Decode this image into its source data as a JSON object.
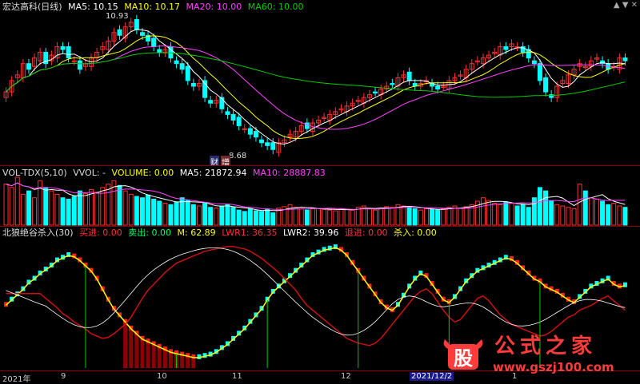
{
  "price_pane": {
    "title": "宏达高科(日线)",
    "ma5": "MA5: 10.15",
    "ma10": "MA10: 10.17",
    "ma20": "MA20: 10.00",
    "ma60": "MA60: 10.00",
    "high_marker": "10.93",
    "low_marker": "8.68",
    "tag_cai": "财",
    "tag_zeng": "增",
    "controls": "▲ ▼ ✕",
    "colors": {
      "ma5": "#ffffff",
      "ma10": "#ffff00",
      "ma20": "#ff44ff",
      "ma60": "#00cc00",
      "up": "#ff3030",
      "down": "#00ffff"
    }
  },
  "volume_pane": {
    "title": "VOL-TDX(5,10)",
    "vvol": "VVOL: -",
    "volume": "VOLUME: 0.00",
    "ma5": "MA5: 21872.94",
    "ma10": "MA10: 28887.83"
  },
  "indicator_pane": {
    "title": "北狼绝谷杀入(30)",
    "buy": "买进: 0.00",
    "sell": "卖出: 0.00",
    "m": "M: 62.89",
    "lwr1": "LWR1: 36.35",
    "lwr2": "LWR2: 39.96",
    "exit": "退进: 0.00",
    "kill": "杀入: 0.00"
  },
  "time_axis": {
    "labels": [
      "2021年",
      "9",
      "10",
      "11",
      "12",
      "2021/12/2",
      "1"
    ],
    "active": "2021/12/2"
  },
  "watermark": {
    "badge": "股",
    "title": "公式之家",
    "url": "www.gszj100.com"
  },
  "chart_data": {
    "type": "candlestick",
    "closes": [
      9.7,
      9.9,
      10.0,
      10.2,
      10.1,
      10.3,
      10.4,
      10.2,
      10.35,
      10.5,
      10.45,
      10.3,
      10.25,
      10.1,
      10.2,
      10.3,
      10.4,
      10.5,
      10.6,
      10.75,
      10.7,
      10.85,
      10.93,
      10.8,
      10.7,
      10.6,
      10.5,
      10.4,
      10.45,
      10.3,
      10.2,
      10.1,
      9.9,
      9.8,
      9.85,
      9.6,
      9.5,
      9.55,
      9.4,
      9.3,
      9.2,
      9.1,
      9.05,
      8.95,
      8.9,
      8.8,
      8.75,
      8.68,
      8.8,
      8.85,
      8.95,
      9.0,
      9.1,
      9.05,
      9.15,
      9.2,
      9.25,
      9.3,
      9.35,
      9.4,
      9.45,
      9.5,
      9.55,
      9.6,
      9.65,
      9.7,
      9.75,
      9.8,
      9.85,
      9.95,
      10.0,
      9.9,
      9.8,
      9.85,
      9.9,
      9.8,
      9.75,
      9.8,
      9.9,
      9.95,
      10.0,
      10.1,
      10.2,
      10.25,
      10.3,
      10.35,
      10.4,
      10.5,
      10.45,
      10.55,
      10.5,
      10.4,
      10.3,
      10.2,
      9.9,
      9.7,
      9.6,
      9.8,
      9.9,
      10.0,
      10.1,
      10.2,
      10.15,
      10.25,
      10.3,
      10.2,
      10.1,
      10.15,
      10.3,
      10.25
    ],
    "volumes": [
      60,
      55,
      70,
      45,
      50,
      40,
      65,
      55,
      50,
      45,
      40,
      38,
      42,
      50,
      46,
      52,
      48,
      55,
      60,
      65,
      58,
      50,
      45,
      42,
      40,
      44,
      38,
      35,
      32,
      30,
      34,
      40,
      36,
      30,
      28,
      32,
      26,
      25,
      28,
      30,
      26,
      22,
      20,
      24,
      21,
      20,
      23,
      18,
      25,
      27,
      30,
      26,
      24,
      22,
      25,
      24,
      23,
      22,
      21,
      24,
      23,
      22,
      26,
      28,
      24,
      22,
      25,
      27,
      26,
      30,
      28,
      26,
      24,
      22,
      24,
      23,
      22,
      24,
      26,
      28,
      25,
      27,
      30,
      35,
      40,
      36,
      32,
      30,
      34,
      32,
      28,
      30,
      26,
      40,
      55,
      50,
      35,
      30,
      28,
      26,
      24,
      60,
      50,
      40,
      38,
      35,
      30,
      32,
      28,
      26
    ],
    "m_line": [
      48,
      52,
      56,
      60,
      65,
      68,
      72,
      75,
      78,
      82,
      84,
      86,
      85,
      82,
      78,
      74,
      68,
      60,
      52,
      45,
      40,
      35,
      30,
      26,
      22,
      20,
      18,
      16,
      14,
      12,
      11,
      10,
      9,
      8,
      8,
      9,
      10,
      12,
      15,
      18,
      22,
      26,
      30,
      35,
      40,
      45,
      52,
      58,
      62,
      66,
      70,
      74,
      78,
      82,
      86,
      88,
      90,
      91,
      92,
      90,
      86,
      80,
      74,
      68,
      62,
      56,
      50,
      46,
      44,
      48,
      55,
      62,
      68,
      72,
      70,
      64,
      58,
      52,
      50,
      54,
      60,
      66,
      70,
      74,
      76,
      78,
      80,
      82,
      84,
      83,
      80,
      76,
      72,
      68,
      66,
      62,
      60,
      58,
      55,
      52,
      50,
      54,
      58,
      62,
      64,
      66,
      68,
      64,
      62,
      63
    ]
  }
}
